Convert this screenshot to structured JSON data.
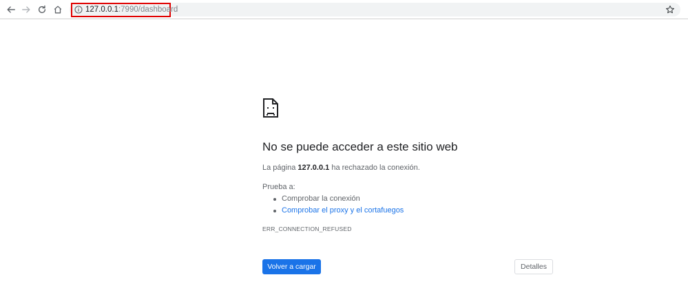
{
  "browser": {
    "url_host": "127.0.0.1",
    "url_path": ":7990/dashboard",
    "icons": {
      "back": "arrow-left-icon",
      "forward": "arrow-right-icon",
      "reload": "reload-icon",
      "home": "home-icon",
      "site_info": "info-icon",
      "bookmark": "star-icon"
    },
    "highlight_color": "#e00000"
  },
  "error_page": {
    "icon": "sad-document-icon",
    "title": "No se puede acceder a este sitio web",
    "description_prefix": "La página",
    "description_host": "127.0.0.1",
    "description_suffix": "ha rechazado la conexión.",
    "suggestions_heading": "Prueba a:",
    "suggestions": [
      "Comprobar la conexión",
      "Comprobar el proxy y el cortafuegos"
    ],
    "error_code": "ERR_CONNECTION_REFUSED",
    "reload_label": "Volver a cargar",
    "details_label": "Detalles",
    "accent_color": "#1a73e8"
  }
}
